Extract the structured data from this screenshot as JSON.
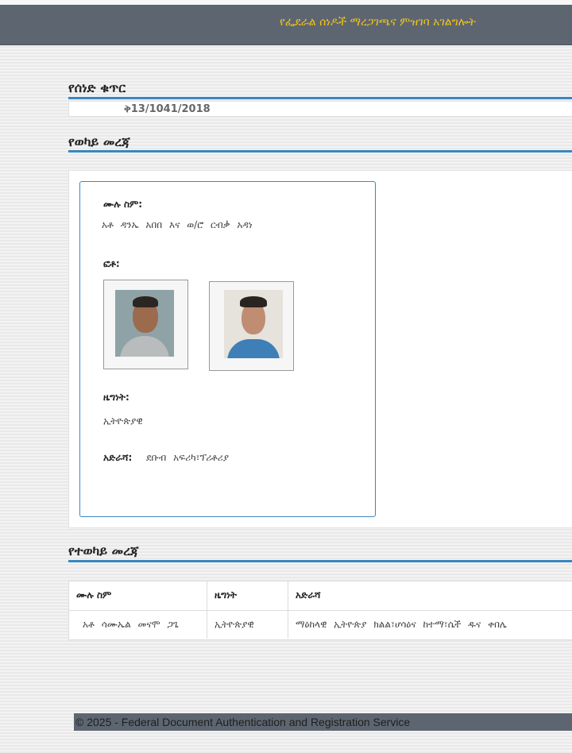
{
  "header": {
    "title": "የፌደራል ሰነዶች ማረጋገጫና ምዝገባ አገልግሎት"
  },
  "document_number": {
    "heading": "የሰነድ ቁጥር",
    "value": "ቅ13/1041/2018"
  },
  "grantor": {
    "heading": "የወካይ መረጃ",
    "full_name_label": "ሙሉ ስም:",
    "full_name": "አቶ ዳንኤ አበበ እና ወ/ሮ ርብቃ አዳነ",
    "photo_label": "ፎቶ:",
    "photos": [
      {
        "name": "grantor-photo-1",
        "icon": "person-photo"
      },
      {
        "name": "grantor-photo-2",
        "icon": "person-photo"
      }
    ],
    "nationality_label": "ዜግነት:",
    "nationality": "ኢትዮጵያዊ",
    "address_label": "አድራሻ:",
    "address": "ደቡብ አፍሪካ፣ፕሪቶሪያ"
  },
  "agent": {
    "heading": "የተወካይ መረጃ",
    "columns": [
      "ሙሉ ስም",
      "ዜግነት",
      "አድራሻ"
    ],
    "rows": [
      [
        "አቶ ሳሙኤል መናሞ ጋጌ",
        "ኢትዮጵያዊ",
        "ማዕከላዊ ኢትዮጵያ ክልል፣ሆሳዕና ከተማ፣ሴች ዱና ቀበሌ"
      ]
    ]
  },
  "footer": {
    "text": "© 2025 - Federal Document Authentication and Registration Service"
  },
  "colors": {
    "header_bg": "#5d6670",
    "header_text": "#f2c318",
    "accent": "#3a87c0"
  }
}
